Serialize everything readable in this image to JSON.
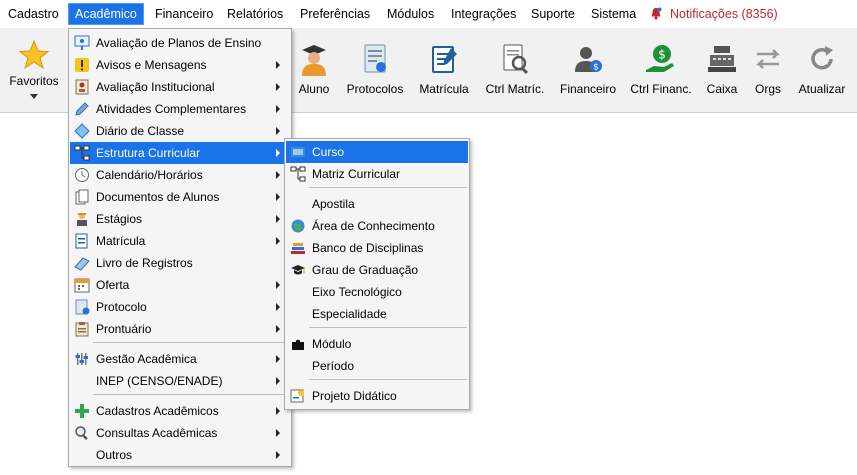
{
  "menubar": {
    "items": [
      "Cadastro",
      "Acadêmico",
      "Financeiro",
      "Relatórios",
      "Preferências",
      "Módulos",
      "Integrações",
      "Suporte",
      "Sistema"
    ],
    "notifications": "Notificações (8356)",
    "colors": {
      "accent": "#1a73e8",
      "notification": "#c0272d"
    }
  },
  "toolbar": {
    "favorites": "Favoritos",
    "buttons": [
      "Aluno",
      "Protocolos",
      "Matrícula",
      "Ctrl Matríc.",
      "Financeiro",
      "Ctrl Financ.",
      "Caixa",
      "Orgs",
      "Atualizar"
    ]
  },
  "menu": {
    "items": [
      "Avaliação de Planos de Ensino",
      "Avisos e Mensagens",
      "Avaliação Institucional",
      "Atividades Complementares",
      "Diário de Classe",
      "Estrutura Curricular",
      "Calendário/Horários",
      "Documentos de Alunos",
      "Estágios",
      "Matrícula",
      "Livro de Registros",
      "Oferta",
      "Protocolo",
      "Prontuário",
      "Gestão Acadêmica",
      "INEP (CENSO/ENADE)",
      "Cadastros Acadêmicos",
      "Consultas Acadêmicas",
      "Outros"
    ]
  },
  "submenu": {
    "items": [
      "Curso",
      "Matriz Curricular",
      "Apostila",
      "Área de Conhecimento",
      "Banco de Disciplinas",
      "Grau de Graduação",
      "Eixo Tecnológico",
      "Especialidade",
      "Módulo",
      "Período",
      "Projeto Didático"
    ]
  }
}
